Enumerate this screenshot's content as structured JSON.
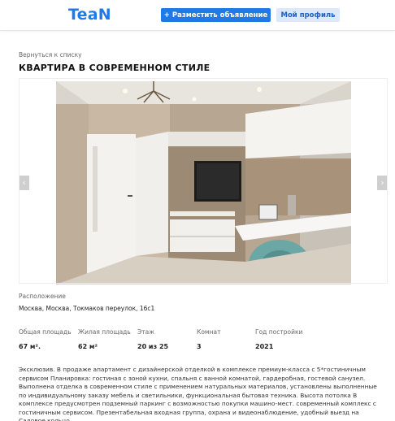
{
  "header": {
    "logo": "TeaN",
    "post_button": "+ Разместить объявление",
    "profile_button": "Мой профиль"
  },
  "back_link": "Вернуться к списку",
  "listing": {
    "title": "КВАРТИРА В СОВРЕМЕННОМ СТИЛЕ",
    "gallery": {
      "prev_icon": "chevron-left-icon",
      "next_icon": "chevron-right-icon",
      "prev_glyph": "‹",
      "next_glyph": "›"
    },
    "location_label": "Расположение",
    "location_value": "Москва, Москва, Токмаков переулок, 16с1",
    "stats": [
      {
        "label": "Общая площадь",
        "value": "67 м²."
      },
      {
        "label": "Жилая площадь",
        "value": "62 м²"
      },
      {
        "label": "Этаж",
        "value": "20 из 25"
      },
      {
        "label": "Комнат",
        "value": "3"
      },
      {
        "label": "Год постройки",
        "value": "2021"
      }
    ],
    "description": "Эксклюзив. В продаже апартамент с дизайнерской отделкой в комплексе премиум-класса с 5*гостиничным сервисом Планировка: гостиная с зоной кухни, спальня с ванной комнатой, гардеробная, гостевой санузел. Выполнена отделка в современном стиле с применением натуральных материалов, установлены выполненные по индивидуальному заказу мебель и светильники, функциональная бытовая техника. Высота потолка В комплексе предусмотрен подземный паркинг с возможностью покупки машино-мест. современный комплекс с гостиничным сервисом. Презентабельная входная группа, охрана и видеонаблюдение, удобный выезд на Садовое кольцо."
  },
  "colors": {
    "brand": "#1f7ae8",
    "secondary_button_bg": "#dde9f8"
  }
}
